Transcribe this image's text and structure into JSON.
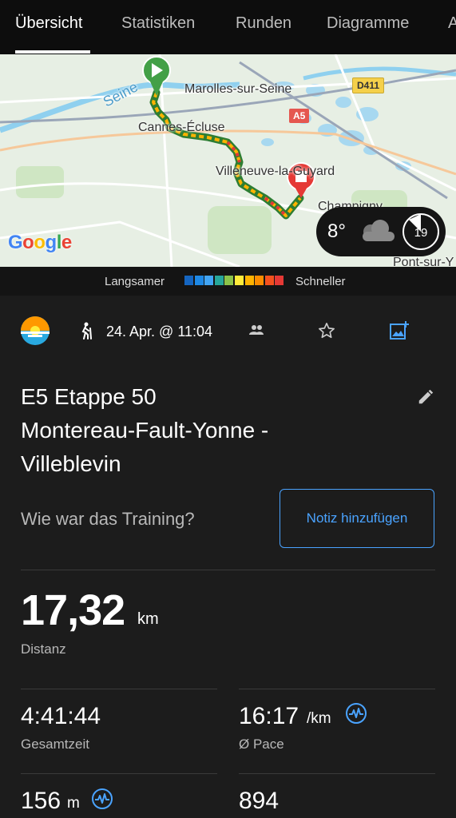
{
  "tabs": [
    {
      "label": "Übersicht",
      "active": true
    },
    {
      "label": "Statistiken"
    },
    {
      "label": "Runden"
    },
    {
      "label": "Diagramme"
    },
    {
      "label": "A"
    }
  ],
  "map": {
    "places": [
      "Marolles-sur-Seine",
      "Cannes-Écluse",
      "Villeneuve-la-Guyard",
      "Champigny",
      "Pont-sur-Y"
    ],
    "river": "Seine",
    "roads": [
      "D411",
      "A5"
    ],
    "attribution": "Google",
    "weather": {
      "temperature": "8°",
      "icon": "cloud-icon",
      "wind": "19"
    }
  },
  "legend": {
    "slower": "Langsamer",
    "faster": "Schneller",
    "colors": [
      "#1565c0",
      "#1e88e5",
      "#42a5f5",
      "#26a69a",
      "#8bc34a",
      "#ffeb3b",
      "#ffb300",
      "#fb8c00",
      "#f4511e",
      "#e53935"
    ]
  },
  "activity": {
    "date": "24. Apr. @ 11:04",
    "title_lines": [
      "E5 Etappe 50",
      "Montereau-Fault-Yonne -",
      "Villeblevin"
    ],
    "feedback_prompt": "Wie war das Training?",
    "note_button": "Notiz hinzufügen"
  },
  "stats": {
    "distance": {
      "value": "17,32",
      "unit": "km",
      "label": "Distanz"
    },
    "total_time": {
      "value": "4:41:44",
      "label": "Gesamtzeit"
    },
    "pace": {
      "value": "16:17",
      "unit": "/km",
      "label": "Ø Pace"
    },
    "elevation": {
      "value": "156",
      "unit": "m"
    },
    "calories": {
      "value": "894"
    }
  },
  "accent": "#4aa3ff"
}
